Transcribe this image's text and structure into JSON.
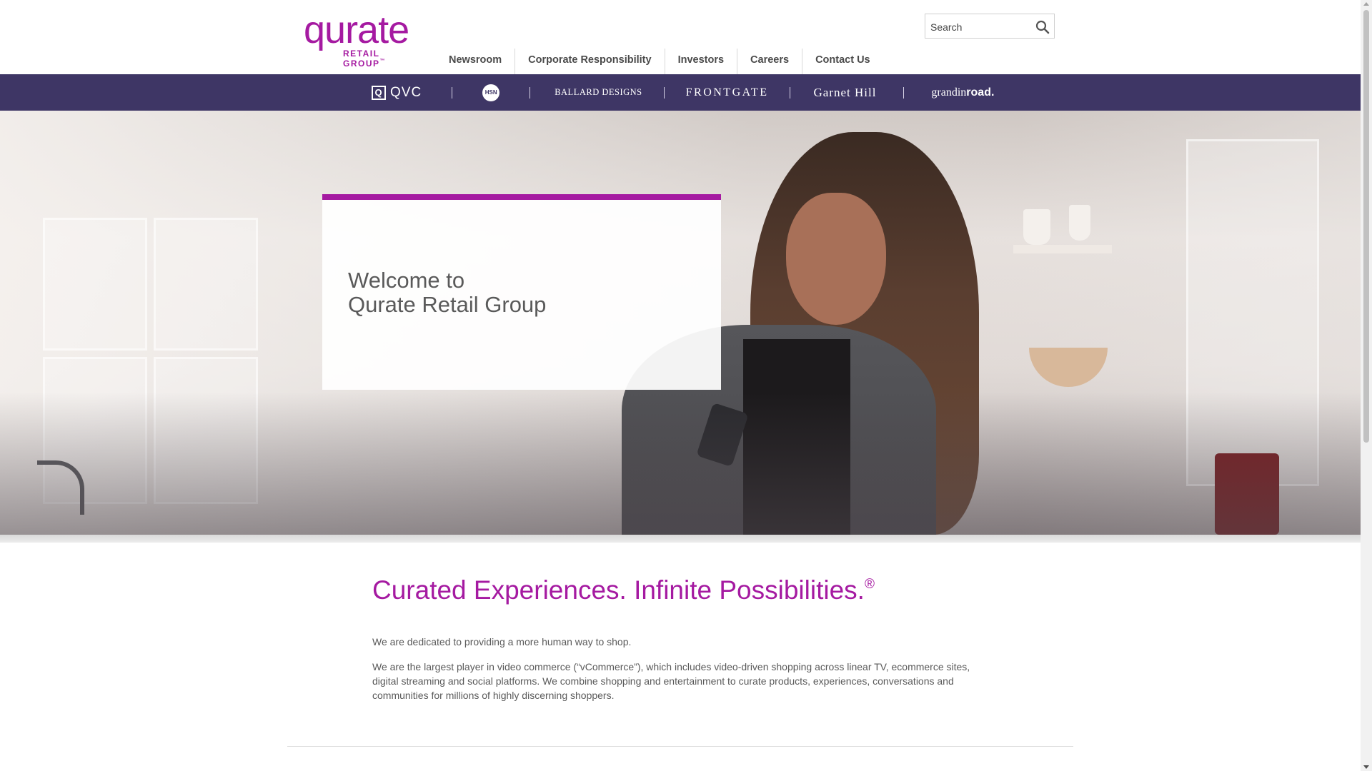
{
  "logo": {
    "word": "qurate",
    "sub": "RETAIL GROUP",
    "tm": "™"
  },
  "nav": [
    {
      "label": "Newsroom"
    },
    {
      "label": "Corporate Responsibility"
    },
    {
      "label": "Investors"
    },
    {
      "label": "Careers"
    },
    {
      "label": "Contact Us"
    }
  ],
  "search": {
    "placeholder": "Search",
    "icon": "search-icon"
  },
  "brands": {
    "qvc": "QVC",
    "qvc_box": "Q",
    "hsn": "HSN",
    "ballard": "BALLARD DESIGNS",
    "frontgate": "FRONTGATE",
    "garnet": "Garnet Hill",
    "grandin_a": "grandin",
    "grandin_b": "road."
  },
  "hero": {
    "line1": "Welcome to",
    "line2": "Qurate Retail Group"
  },
  "content": {
    "tagline": "Curated Experiences. Infinite Possibilities.",
    "tagline_mark": "®",
    "para1": "We are dedicated to providing a more human way to shop.",
    "para2": "We are the largest player in video commerce (“vCommerce”), which includes video-driven shopping across linear TV, ecommerce sites, digital streaming and social platforms. We combine shopping and entertainment to curate products, experiences, conversations and communities for millions of highly discerning shoppers."
  },
  "colors": {
    "brand_purple": "#a51aa1",
    "brand_bar": "#3e3665"
  }
}
